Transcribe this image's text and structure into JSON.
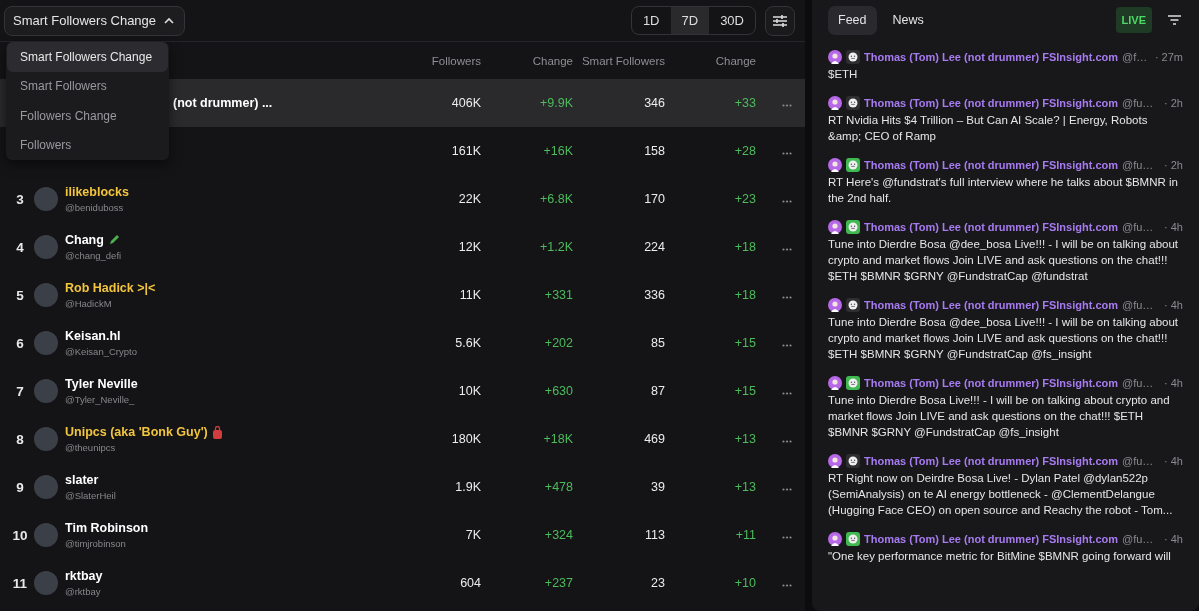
{
  "sort_dropdown": {
    "label": "Smart Followers Change",
    "expanded": true,
    "options": [
      {
        "label": "Smart Followers Change",
        "selected": true
      },
      {
        "label": "Smart Followers",
        "selected": false
      },
      {
        "label": "Followers Change",
        "selected": false
      },
      {
        "label": "Followers",
        "selected": false
      }
    ]
  },
  "periods": [
    {
      "label": "1D",
      "selected": false
    },
    {
      "label": "7D",
      "selected": true
    },
    {
      "label": "30D",
      "selected": false
    }
  ],
  "table": {
    "columns": [
      "Followers",
      "Change",
      "Smart Followers",
      "Change"
    ],
    "rows": [
      {
        "name": "(not drummer) ...",
        "color": "#ffffff",
        "kind": "plain",
        "followers": "406K",
        "change": "+9.9K",
        "smart_followers": "346",
        "smart_change": "+33",
        "selected": true
      },
      {
        "followers": "161K",
        "change": "+16K",
        "smart_followers": "158",
        "smart_change": "+28",
        "selected": false
      },
      {
        "rank": "3",
        "name": "ilikeblocks",
        "handle": "@beniduboss",
        "color": "#f2c53d",
        "kind": "plain",
        "followers": "22K",
        "change": "+6.8K",
        "smart_followers": "170",
        "smart_change": "+23",
        "selected": false
      },
      {
        "rank": "4",
        "name": "Chang",
        "handle": "@chang_defi",
        "color": "#ffffff",
        "kind": "pencil_mark",
        "followers": "12K",
        "change": "+1.2K",
        "smart_followers": "224",
        "smart_change": "+18",
        "selected": false
      },
      {
        "rank": "5",
        "name": "Rob Hadick >|<",
        "handle": "@HadickM",
        "color": "#f2c53d",
        "kind": "plain",
        "followers": "11K",
        "change": "+331",
        "smart_followers": "336",
        "smart_change": "+18",
        "selected": false
      },
      {
        "rank": "6",
        "name": "Keisan.hl",
        "handle": "@Keisan_Crypto",
        "color": "#ffffff",
        "kind": "plain",
        "followers": "5.6K",
        "change": "+202",
        "smart_followers": "85",
        "smart_change": "+15",
        "selected": false
      },
      {
        "rank": "7",
        "name": "Tyler Neville",
        "handle": "@Tyler_Neville_",
        "color": "#ffffff",
        "kind": "plain",
        "followers": "10K",
        "change": "+630",
        "smart_followers": "87",
        "smart_change": "+15",
        "selected": false
      },
      {
        "rank": "8",
        "name": "Unipcs (aka 'Bonk Guy')",
        "handle": "@theunipcs",
        "color": "#f2c53d",
        "kind": "bag_mark",
        "followers": "180K",
        "change": "+18K",
        "smart_followers": "469",
        "smart_change": "+13",
        "selected": false
      },
      {
        "rank": "9",
        "name": "slater",
        "handle": "@SlaterHeil",
        "color": "#ffffff",
        "kind": "plain",
        "followers": "1.9K",
        "change": "+478",
        "smart_followers": "39",
        "smart_change": "+13",
        "selected": false
      },
      {
        "rank": "10",
        "name": "Tim Robinson",
        "handle": "@timjrobinson",
        "color": "#ffffff",
        "kind": "plain",
        "followers": "7K",
        "change": "+324",
        "smart_followers": "113",
        "smart_change": "+11",
        "selected": false
      },
      {
        "rank": "11",
        "name": "rktbay",
        "handle": "@rktbay",
        "color": "#ffffff",
        "kind": "plain",
        "followers": "604",
        "change": "+237",
        "smart_followers": "23",
        "smart_change": "+10",
        "selected": false
      }
    ]
  },
  "feed": {
    "tabs": [
      {
        "label": "Feed",
        "selected": true
      },
      {
        "label": "News",
        "selected": false
      }
    ],
    "live_badge": "LIVE",
    "posts": [
      {
        "author": "Thomas (Tom) Lee (not drummer) FSInsight.com",
        "handle": "@f…",
        "time": "· 27m",
        "color": "#2e2e31",
        "text": "$ETH"
      },
      {
        "author": "Thomas (Tom) Lee (not drummer) FSInsight.com",
        "handle": "@fu…",
        "time": "· 2h",
        "color": "#2e2e31",
        "text": "RT Nvidia Hits $4 Trillion – But Can AI Scale? | Energy, Robots &amp; CEO of Ramp"
      },
      {
        "author": "Thomas (Tom) Lee (not drummer) FSInsight.com",
        "handle": "@fu…",
        "time": "· 2h",
        "color": "#3fb950",
        "text": "RT Here's @fundstrat's full interview where he talks about $BMNR in the 2nd half."
      },
      {
        "author": "Thomas (Tom) Lee (not drummer) FSInsight.com",
        "handle": "@fu…",
        "time": "· 4h",
        "color": "#3fb950",
        "text": "Tune into Dierdre Bosa @dee_bosa Live!!! - I will be on talking about crypto and market flows Join LIVE and ask questions on the chat!!! $ETH $BMNR $GRNY @FundstratCap @fundstrat"
      },
      {
        "author": "Thomas (Tom) Lee (not drummer) FSInsight.com",
        "handle": "@fu…",
        "time": "· 4h",
        "color": "#2e2e31",
        "text": "Tune into Dierdre Bosa @dee_bosa Live!!! - I will be on talking about crypto and market flows Join LIVE and ask questions on the chat!!! $ETH $BMNR $GRNY @FundstratCap @fs_insight"
      },
      {
        "author": "Thomas (Tom) Lee (not drummer) FSInsight.com",
        "handle": "@fu…",
        "time": "· 4h",
        "color": "#3fb950",
        "text": "Tune into Dierdre Bosa Live!!! - I will be on talking about crypto and market flows Join LIVE and ask questions on the chat!!! $ETH $BMNR $GRNY @FundstratCap @fs_insight"
      },
      {
        "author": "Thomas (Tom) Lee (not drummer) FSInsight.com",
        "handle": "@fu…",
        "time": "· 4h",
        "color": "#2e2e31",
        "text": "RT Right now on Deirdre Bosa Live! - Dylan Patel @dylan522p (SemiAnalysis) on te AI energy bottleneck - @ClementDelangue (Hugging Face CEO) on open source and Reachy the robot - Tom..."
      },
      {
        "author": "Thomas (Tom) Lee (not drummer) FSInsight.com",
        "handle": "@fu…",
        "time": "· 4h",
        "color": "#3fb950",
        "text": "\"One key performance metric for BitMine $BMNR going forward will"
      }
    ]
  }
}
